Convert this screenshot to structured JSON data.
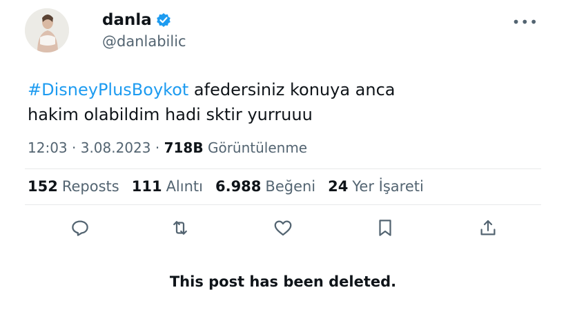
{
  "author": {
    "display_name": "danla",
    "handle": "@danlabilic",
    "verified": true
  },
  "tweet": {
    "hashtag": "#DisneyPlusBoykot",
    "text_line1": " afedersiniz konuya anca",
    "text_line2": "hakim olabildim hadi sktir yurruuu"
  },
  "meta": {
    "time": "12:03",
    "date": "3.08.2023",
    "views_count": "718B",
    "views_label": "Görüntülenme",
    "separator": "·"
  },
  "stats": [
    {
      "count": "152",
      "label": "Reposts"
    },
    {
      "count": "111",
      "label": "Alıntı"
    },
    {
      "count": "6.988",
      "label": "Beğeni"
    },
    {
      "count": "24",
      "label": "Yer İşareti"
    }
  ],
  "actions": [
    "reply-icon",
    "repost-icon",
    "like-icon",
    "bookmark-icon",
    "share-icon"
  ],
  "notice": "This post has been deleted.",
  "colors": {
    "accent": "#1d9bf0",
    "text": "#0f1419",
    "secondary": "#536471",
    "divider": "#e7e9ea"
  }
}
